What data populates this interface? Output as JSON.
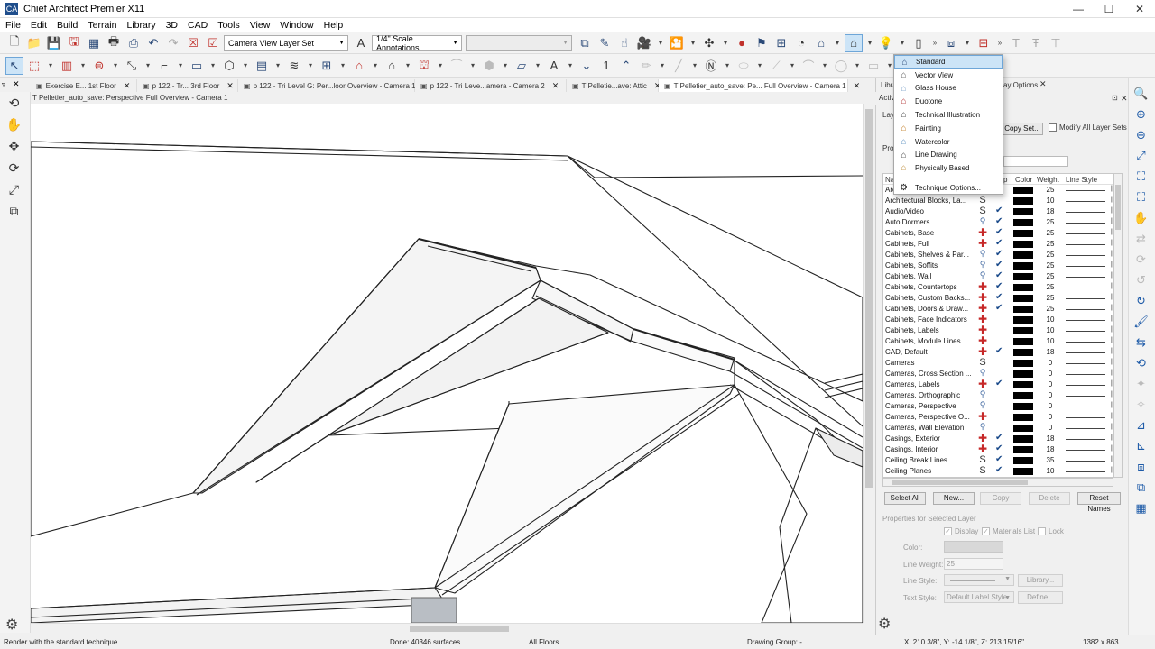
{
  "window": {
    "title": "Chief Architect Premier X11",
    "app_icon": "CA"
  },
  "menu": [
    "File",
    "Edit",
    "Build",
    "Terrain",
    "Library",
    "3D",
    "CAD",
    "Tools",
    "View",
    "Window",
    "Help"
  ],
  "toolbar": {
    "layer_set_value": "Camera View Layer Set",
    "annotation_value": "1/4\" Scale Annotations",
    "number_label": "1"
  },
  "tabs": [
    {
      "label": "Exercise E... 1st Floor",
      "active": false
    },
    {
      "label": "p 122 - Tr... 3rd Floor",
      "active": false
    },
    {
      "label": "p 122 - Tri Level G: Per...loor Overview - Camera 1",
      "active": false
    },
    {
      "label": "p 122 - Tri Leve...amera - Camera 2",
      "active": false
    },
    {
      "label": "T Pelletie...ave: Attic",
      "active": false
    },
    {
      "label": "T Pelletier_auto_save: Pe... Full Overview - Camera 1",
      "active": true
    }
  ],
  "view_title": "T Pelletier_auto_save: Perspective Full Overview - Camera 1",
  "right_panel": {
    "tabs": {
      "library": "Libra",
      "display": "ay Options"
    },
    "header": "Activ",
    "layer_set_label": "Laye",
    "copy_set_button": "Copy Set...",
    "modify_all_label": "Modify All Layer Sets",
    "prop_label": "Prop",
    "columns": {
      "name": "Na",
      "vis": "p",
      "color": "Color",
      "weight": "Weight",
      "line_style": "Line Style"
    },
    "layers": [
      {
        "name": "Arc",
        "vis": "hand",
        "chk": false,
        "w": "25"
      },
      {
        "name": "Architectural Blocks, La...",
        "vis": "s",
        "chk": false,
        "w": "10"
      },
      {
        "name": "Audio/Video",
        "vis": "s",
        "chk": true,
        "w": "18"
      },
      {
        "name": "Auto Dormers",
        "vis": "hand",
        "chk": true,
        "w": "25"
      },
      {
        "name": "Cabinets,  Base",
        "vis": "plus",
        "chk": true,
        "w": "25"
      },
      {
        "name": "Cabinets,  Full",
        "vis": "plus",
        "chk": true,
        "w": "25"
      },
      {
        "name": "Cabinets,  Shelves & Par...",
        "vis": "hand",
        "chk": true,
        "w": "25"
      },
      {
        "name": "Cabinets,  Soffits",
        "vis": "hand",
        "chk": true,
        "w": "25"
      },
      {
        "name": "Cabinets,  Wall",
        "vis": "hand",
        "chk": true,
        "w": "25"
      },
      {
        "name": "Cabinets,  Countertops",
        "vis": "plus",
        "chk": true,
        "w": "25"
      },
      {
        "name": "Cabinets, Custom Backs...",
        "vis": "plus",
        "chk": true,
        "w": "25"
      },
      {
        "name": "Cabinets, Doors & Draw...",
        "vis": "plus",
        "chk": true,
        "w": "25"
      },
      {
        "name": "Cabinets, Face Indicators",
        "vis": "plus",
        "chk": false,
        "w": "10"
      },
      {
        "name": "Cabinets, Labels",
        "vis": "plus",
        "chk": false,
        "w": "10"
      },
      {
        "name": "Cabinets, Module Lines",
        "vis": "plus",
        "chk": false,
        "w": "10"
      },
      {
        "name": "CAD,  Default",
        "vis": "plus",
        "chk": true,
        "w": "18"
      },
      {
        "name": "Cameras",
        "vis": "s",
        "chk": false,
        "w": "0"
      },
      {
        "name": "Cameras, Cross Section ...",
        "vis": "hand",
        "chk": false,
        "w": "0"
      },
      {
        "name": "Cameras, Labels",
        "vis": "plus",
        "chk": true,
        "w": "0"
      },
      {
        "name": "Cameras, Orthographic",
        "vis": "hand",
        "chk": false,
        "w": "0"
      },
      {
        "name": "Cameras, Perspective",
        "vis": "hand",
        "chk": false,
        "w": "0"
      },
      {
        "name": "Cameras, Perspective O...",
        "vis": "plus",
        "chk": false,
        "w": "0"
      },
      {
        "name": "Cameras, Wall Elevation",
        "vis": "hand",
        "chk": false,
        "w": "0"
      },
      {
        "name": "Casings, Exterior",
        "vis": "plus",
        "chk": true,
        "w": "18"
      },
      {
        "name": "Casings, Interior",
        "vis": "plus",
        "chk": true,
        "w": "18"
      },
      {
        "name": "Ceiling Break Lines",
        "vis": "s",
        "chk": true,
        "w": "35"
      },
      {
        "name": "Ceiling Planes",
        "vis": "s",
        "chk": true,
        "w": "10"
      }
    ],
    "buttons": {
      "select_all": "Select All",
      "new": "New...",
      "copy": "Copy",
      "delete": "Delete",
      "reset_names": "Reset Names"
    },
    "selected_props": {
      "header": "Properties for Selected Layer",
      "display": "Display",
      "materials_list": "Materials List",
      "lock": "Lock",
      "color_label": "Color:",
      "line_weight_label": "Line Weight:",
      "line_weight_value": "25",
      "line_style_label": "Line Style:",
      "library_button": "Library...",
      "text_style_label": "Text Style:",
      "text_style_value": "Default Label Style",
      "define_button": "Define..."
    }
  },
  "dropdown": {
    "items": [
      {
        "label": "Standard",
        "icon": "house-standard-icon",
        "highlighted": true
      },
      {
        "label": "Vector View",
        "icon": "vector-view-icon",
        "highlighted": false
      },
      {
        "label": "Glass House",
        "icon": "glass-house-icon",
        "highlighted": false
      },
      {
        "label": "Duotone",
        "icon": "duotone-icon",
        "highlighted": false
      },
      {
        "label": "Technical Illustration",
        "icon": "technical-illustration-icon",
        "highlighted": false
      },
      {
        "label": "Painting",
        "icon": "painting-icon",
        "highlighted": false
      },
      {
        "label": "Watercolor",
        "icon": "watercolor-icon",
        "highlighted": false
      },
      {
        "label": "Line Drawing",
        "icon": "line-drawing-icon",
        "highlighted": false
      },
      {
        "label": "Physically Based",
        "icon": "physically-based-icon",
        "highlighted": false
      }
    ],
    "technique_options": "Technique Options..."
  },
  "status": {
    "message": "Render with the standard technique.",
    "done": "Done:  40346 surfaces",
    "floors": "All Floors",
    "drawing_group": "Drawing Group: -",
    "coords": "X: 210 3/8\", Y: -14 1/8\", Z: 213 15/16\"",
    "resolution": "1382 x 863"
  },
  "colors": {
    "highlight": "#cce4f7",
    "accent": "#1e5ba8",
    "red": "#c62828"
  }
}
